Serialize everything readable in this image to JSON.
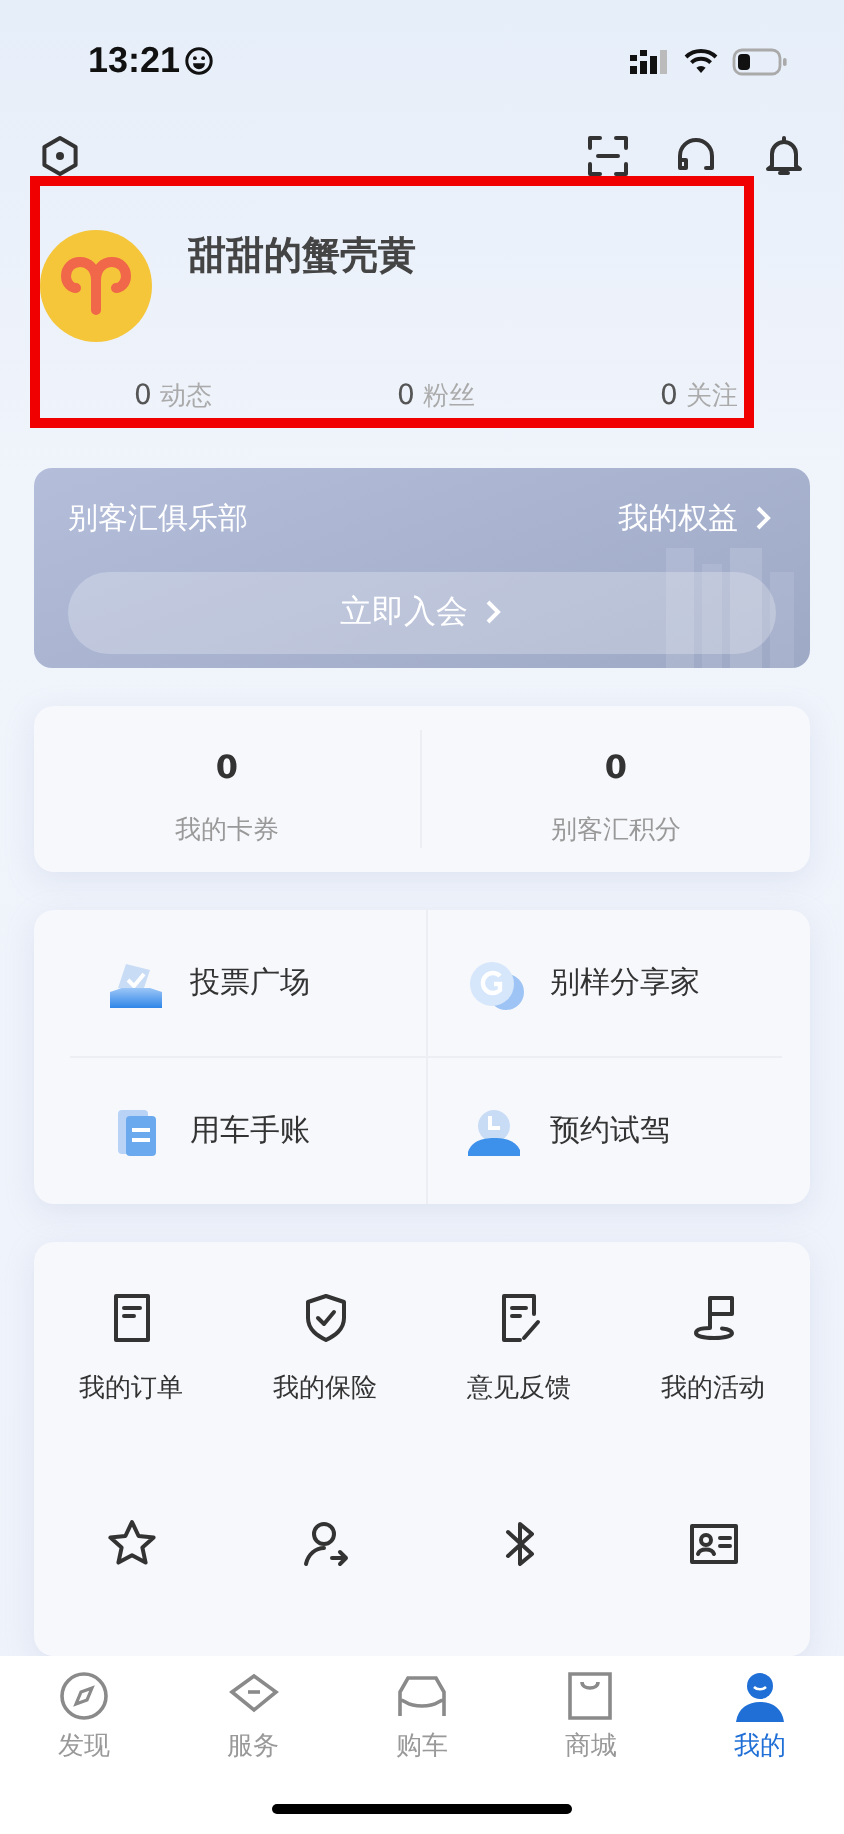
{
  "status_bar": {
    "time": "13:21"
  },
  "profile": {
    "name": "甜甜的蟹壳黄",
    "highlighted": true,
    "stats": [
      {
        "value": "0",
        "label": "动态"
      },
      {
        "value": "0",
        "label": "粉丝"
      },
      {
        "value": "0",
        "label": "关注"
      }
    ]
  },
  "club": {
    "title": "别客汇俱乐部",
    "link": "我的权益",
    "button": "立即入会"
  },
  "summary": [
    {
      "value": "0",
      "label": "我的卡券"
    },
    {
      "value": "0",
      "label": "别客汇积分"
    }
  ],
  "features": [
    {
      "label": "投票广场"
    },
    {
      "label": "别样分享家"
    },
    {
      "label": "用车手账"
    },
    {
      "label": "预约试驾"
    }
  ],
  "services": [
    {
      "label": "我的订单"
    },
    {
      "label": "我的保险"
    },
    {
      "label": "意见反馈"
    },
    {
      "label": "我的活动"
    }
  ],
  "tabs": [
    {
      "label": "发现",
      "selected": false
    },
    {
      "label": "服务",
      "selected": false
    },
    {
      "label": "购车",
      "selected": false
    },
    {
      "label": "商城",
      "selected": false
    },
    {
      "label": "我的",
      "selected": true
    }
  ]
}
